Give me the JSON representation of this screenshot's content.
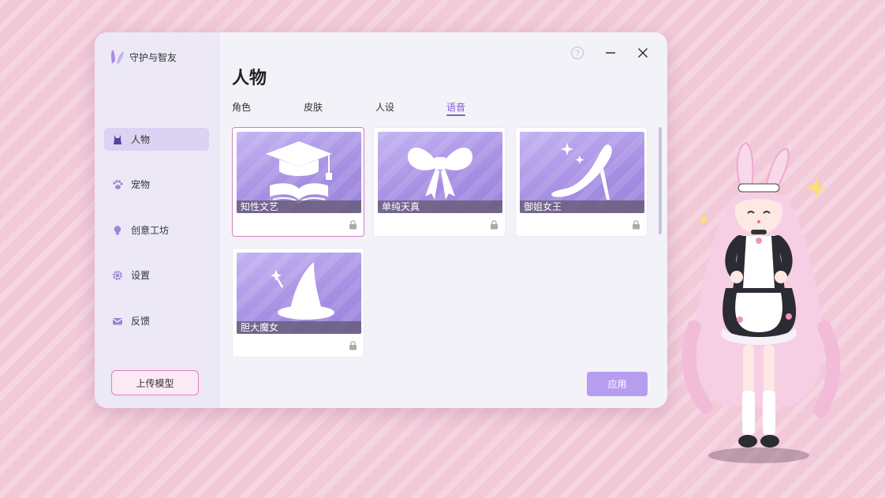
{
  "app": {
    "name": "守护与智友"
  },
  "sidebar": {
    "items": [
      {
        "label": "人物",
        "icon": "character-icon",
        "active": true
      },
      {
        "label": "宠物",
        "icon": "paw-icon",
        "active": false
      },
      {
        "label": "创意工坊",
        "icon": "lightbulb-icon",
        "active": false
      },
      {
        "label": "设置",
        "icon": "gear-icon",
        "active": false
      },
      {
        "label": "反馈",
        "icon": "mail-icon",
        "active": false
      }
    ],
    "upload_label": "上传模型"
  },
  "main": {
    "title": "人物",
    "tabs": [
      {
        "label": "角色",
        "active": false
      },
      {
        "label": "皮肤",
        "active": false
      },
      {
        "label": "人设",
        "active": false
      },
      {
        "label": "语音",
        "active": true
      }
    ],
    "cards": [
      {
        "label": "知性文艺",
        "icon": "graduation-cap-book-icon",
        "selected": true,
        "locked": true
      },
      {
        "label": "单纯天真",
        "icon": "bow-icon",
        "selected": false,
        "locked": true
      },
      {
        "label": "御姐女王",
        "icon": "high-heel-icon",
        "selected": false,
        "locked": true
      },
      {
        "label": "胆大魔女",
        "icon": "witch-hat-icon",
        "selected": false,
        "locked": true
      }
    ],
    "apply_label": "应用"
  },
  "colors": {
    "accent": "#7d5fd0",
    "apply_button": "#b79df0",
    "selected_border": "#d67ec1",
    "card_gradient": "#a58ee2",
    "background": "#f1c9d8"
  }
}
